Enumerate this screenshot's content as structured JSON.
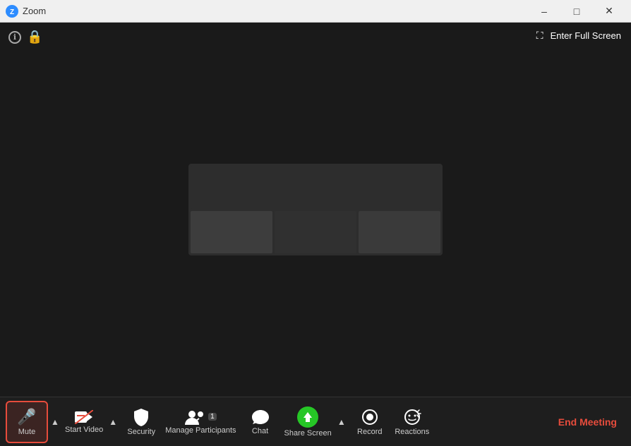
{
  "titleBar": {
    "appName": "Zoom",
    "controls": {
      "minimize": "–",
      "maximize": "□",
      "close": "✕"
    }
  },
  "topBar": {
    "fullscreenLabel": "Enter Full Screen"
  },
  "toolbar": {
    "mute": "Mute",
    "startVideo": "Start Video",
    "security": "Security",
    "manageParticipants": "Manage Participants",
    "participantsCount": "1",
    "chat": "Chat",
    "shareScreen": "Share Screen",
    "record": "Record",
    "reactions": "Reactions",
    "endMeeting": "End Meeting"
  },
  "icons": {
    "info": "ℹ",
    "lock": "🔒",
    "mic": "🎤",
    "video_off": "📹",
    "shield": "🛡",
    "people": "👥",
    "chat_bubble": "💬",
    "share_up": "↑",
    "record_circle": "⏺",
    "emoji_plus": "😊",
    "chevron_up": "^",
    "fullscreen": "⛶"
  }
}
